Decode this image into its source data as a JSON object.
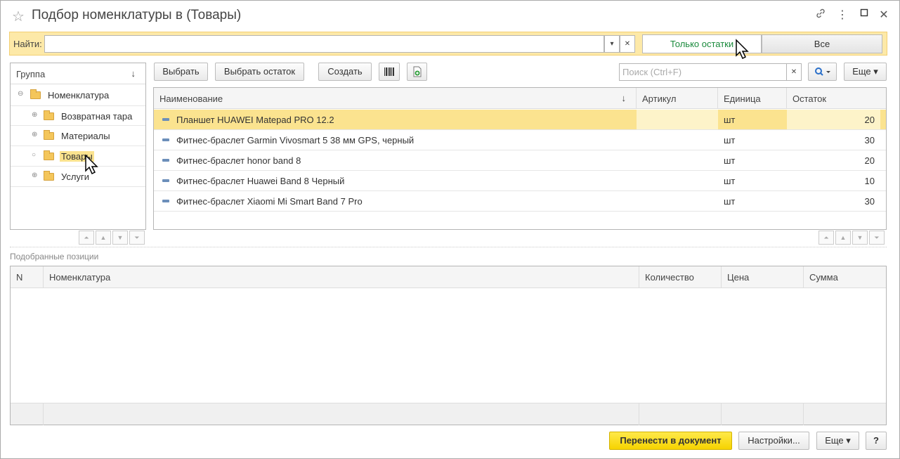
{
  "window": {
    "title": "Подбор номенклатуры в  (Товары)"
  },
  "search": {
    "label": "Найти:",
    "value": "",
    "toggle_left": "Только остатки",
    "toggle_right": "Все"
  },
  "tree": {
    "header": "Группа",
    "items": [
      {
        "label": "Номенклатура",
        "toggle": "⊖"
      },
      {
        "label": "Возвратная тара",
        "toggle": "⊕"
      },
      {
        "label": "Материалы",
        "toggle": "⊕"
      },
      {
        "label": "Товары",
        "toggle": "○"
      },
      {
        "label": "Услуги",
        "toggle": "⊕"
      }
    ]
  },
  "toolbar": {
    "select": "Выбрать",
    "select_rest": "Выбрать остаток",
    "create": "Создать",
    "search_placeholder": "Поиск (Ctrl+F)",
    "more": "Еще"
  },
  "grid": {
    "columns": [
      "Наименование",
      "Артикул",
      "Единица",
      "Остаток"
    ],
    "rows": [
      {
        "name": "Планшет HUAWEI Matepad PRO 12.2",
        "article": "",
        "unit": "шт",
        "rest": "20"
      },
      {
        "name": "Фитнес-браслет Garmin Vivosmart 5 38 мм GPS, черный",
        "article": "",
        "unit": "шт",
        "rest": "30"
      },
      {
        "name": "Фитнес-браслет honor band 8",
        "article": "",
        "unit": "шт",
        "rest": "20"
      },
      {
        "name": "Фитнес-браслет Huawei Band 8 Черный",
        "article": "",
        "unit": "шт",
        "rest": "10"
      },
      {
        "name": "Фитнес-браслет Xiaomi Mi Smart Band 7 Pro",
        "article": "",
        "unit": "шт",
        "rest": "30"
      }
    ]
  },
  "picked": {
    "label": "Подобранные позиции",
    "columns": [
      "N",
      "Номенклатура",
      "Количество",
      "Цена",
      "Сумма"
    ]
  },
  "footer": {
    "transfer": "Перенести в документ",
    "settings": "Настройки...",
    "more": "Еще",
    "help": "?"
  }
}
